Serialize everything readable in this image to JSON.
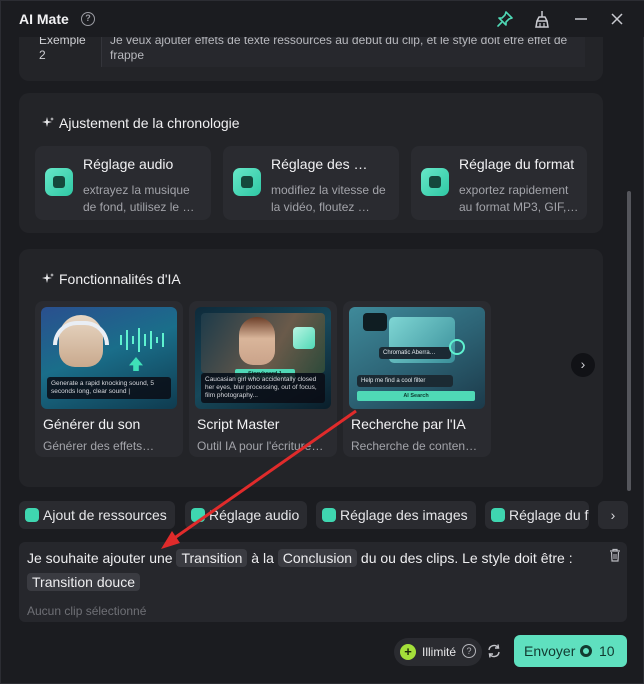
{
  "app": {
    "title": "AI Mate"
  },
  "example": {
    "tag": "Exemple 2",
    "text": "Je veux ajouter effets de texte ressources au début du clip, et le style doit être effet de frappe"
  },
  "timeline": {
    "title": "Ajustement de la chronologie",
    "items": [
      {
        "name": "Réglage audio",
        "desc": "extrayez la musique de fond, utilisez le …"
      },
      {
        "name": "Réglage des …",
        "desc": "modifiez la vitesse de la vidéo, floutez …"
      },
      {
        "name": "Réglage du format",
        "desc": "exportez rapidement au format MP3, GIF,…"
      }
    ]
  },
  "ai_features": {
    "title": "Fonctionnalités d'IA",
    "items": [
      {
        "name": "Générer du son",
        "desc": "Générer des effets…",
        "thumb_text": "Generate a rapid knocking sound, 5 seconds long, clear sound |"
      },
      {
        "name": "Script Master",
        "desc": "Outil IA pour l'écriture…",
        "thumb_badge": "Storyboard 1",
        "thumb_text": "Caucasian girl who accidentally closed her eyes, blur processing, out of focus, film photography..."
      },
      {
        "name": "Recherche par l'IA",
        "desc": "Recherche de conten…",
        "thumb_badge": "Chromatic Aberra…",
        "thumb_text": "Help me find a cool filter",
        "thumb_button": "AI Search"
      }
    ]
  },
  "chips": [
    "Ajout de ressources",
    "Réglage audio",
    "Réglage des images",
    "Réglage du f"
  ],
  "prompt": {
    "part1": "Je souhaite ajouter une",
    "pill1": "Transition",
    "part2": "à la",
    "pill2": "Conclusion",
    "part3": "du ou des clips. Le style doit être :",
    "pill3": "Transition douce",
    "status": "Aucun clip sélectionné"
  },
  "footer": {
    "unlimited_label": "Illimité",
    "send_label": "Envoyer",
    "send_credits": "10"
  },
  "colors": {
    "accent": "#5fe0bf",
    "annotation_arrow": "#e02b2b"
  }
}
